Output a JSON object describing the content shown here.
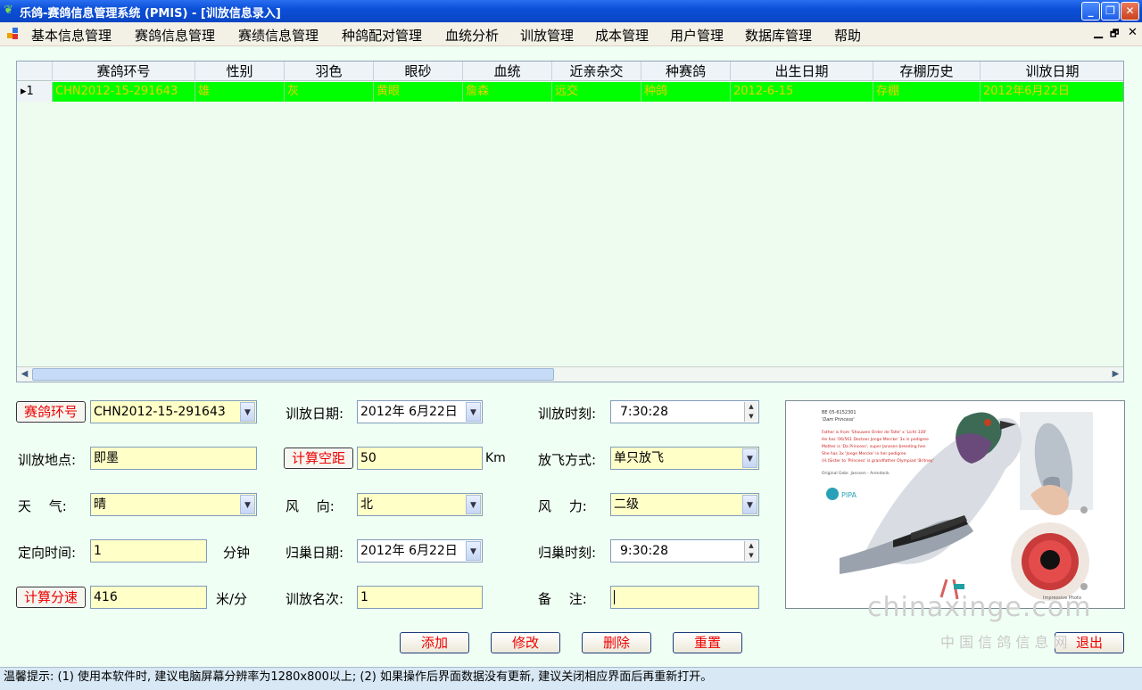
{
  "window": {
    "title": "乐鸽-赛鸽信息管理系统 (PMIS)  - [训放信息录入]",
    "controls": [
      "_",
      "❐",
      "✕"
    ]
  },
  "menu": {
    "items": [
      "基本信息管理",
      "赛鸽信息管理",
      "赛绩信息管理",
      "种鸽配对管理",
      "血统分析",
      "训放管理",
      "成本管理",
      "用户管理",
      "数据库管理",
      "帮助"
    ],
    "mdi_controls": [
      "▁",
      "🗗",
      "✕"
    ]
  },
  "grid": {
    "columns": [
      "赛鸽环号",
      "性别",
      "羽色",
      "眼砂",
      "血统",
      "近亲杂交",
      "种赛鸽",
      "出生日期",
      "存棚历史",
      "训放日期"
    ],
    "rows": [
      {
        "row_id": "1",
        "cells": [
          "CHN2012-15-291643",
          "雄",
          "灰",
          "黄眼",
          "詹森",
          "远交",
          "种鸽",
          "2012-6-15",
          "存棚",
          "2012年6月22日"
        ]
      }
    ]
  },
  "form": {
    "ring_btn": "赛鸽环号",
    "ring_value": "CHN2012-15-291643",
    "train_date_label": "训放日期:",
    "train_date_value": "2012年 6月22日",
    "train_time_label": "训放时刻:",
    "train_time_value": "7:30:28",
    "location_label": "训放地点:",
    "location_value": "即墨",
    "calc_dist_btn": "计算空距",
    "dist_value": "50",
    "dist_unit": "Km",
    "release_mode_label": "放飞方式:",
    "release_mode_value": "单只放飞",
    "weather_label": "天　 气:",
    "weather_value": "晴",
    "wind_dir_label": "风　 向:",
    "wind_dir_value": "北",
    "wind_force_label": "风　 力:",
    "wind_force_value": "二级",
    "orient_label": "定向时间:",
    "orient_value": "1",
    "orient_unit": "分钟",
    "return_date_label": "归巢日期:",
    "return_date_value": "2012年 6月22日",
    "return_time_label": "归巢时刻:",
    "return_time_value": "9:30:28",
    "calc_speed_btn": "计算分速",
    "speed_value": "416",
    "speed_unit": "米/分",
    "rank_label": "训放名次:",
    "rank_value": "1",
    "note_label": "备　 注:",
    "note_value": ""
  },
  "actions": {
    "add": "添加",
    "edit": "修改",
    "delete": "删除",
    "reset": "重置",
    "exit": "退出"
  },
  "photo": {
    "card_lines": [
      "BE 05-6152301",
      "'Dam Princess'",
      "Father is from 'Shouwen Order de Tafel' x 'Licht 330'",
      "He has '06/561 Doctoer Jonge Mercke' 3x in pedigree",
      "Mother is 'Da Princess', super Janssen breeding hen",
      "She has 3x 'Jonge Mercke' in her pedigree",
      "(H.)Sister to 'Princess' is grandfather Olympiad 'Britney'",
      "Original Gebr. Janssen - Arendonk"
    ],
    "logo": "PIPA",
    "caption": "Impressive Photo"
  },
  "status": {
    "text": "温馨提示: (1) 使用本软件时, 建议电脑屏幕分辨率为1280x800以上; (2) 如果操作后界面数据没有更新, 建议关闭相应界面后再重新打开。"
  },
  "watermark": {
    "site": "chinaxinge.com",
    "name": "中 国 信 鸽 信 息 网"
  },
  "colors": {
    "selected_row": "#00ff00",
    "selected_text": "#e6d100",
    "input_bg": "#ffffc8",
    "button_text": "#e00000",
    "titlebar": "#0b4fd8"
  }
}
